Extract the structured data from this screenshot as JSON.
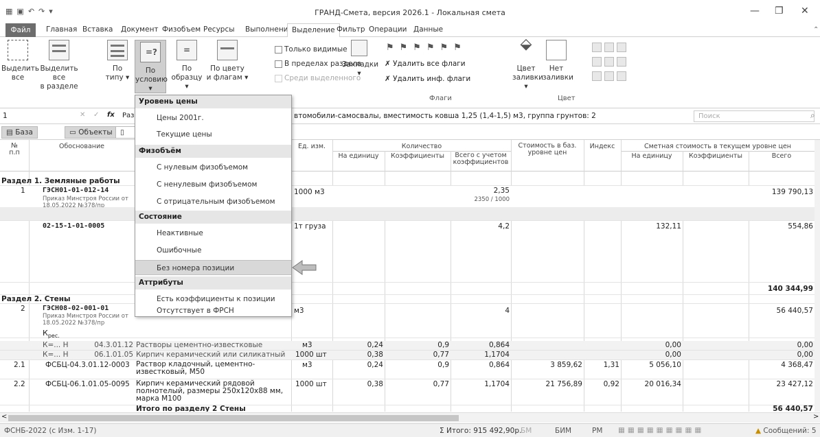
{
  "window": {
    "title": "ГРАНД-Смета, версия 2026.1 - Локальная смета"
  },
  "ribbon_tabs": [
    "Файл",
    "Главная",
    "Вставка",
    "Документ",
    "Физобъем",
    "Ресурсы",
    "Выполнение",
    "Выделение",
    "Фильтр",
    "Операции",
    "Данные"
  ],
  "ribbon": {
    "select_all": "Выделить\nвсе",
    "select_in_section": "Выделить все\nв разделе",
    "by_type": "По\nтипу ▾",
    "by_condition": "По\nусловию ▾",
    "by_sample": "По\nобразцу ▾",
    "by_color": "По цвету\nи флагам ▾",
    "only_visible": "Только видимые",
    "within_section": "В пределах раздела",
    "among_selected": "Среди выделенного",
    "bookmarks": "Закладки\n▾",
    "remove_all_flags": "Удалить все флаги",
    "remove_info_flags": "Удалить инф. флаги",
    "flags_group": "Флаги",
    "fill_color": "Цвет\nзаливки ▾",
    "no_fill": "Нет\nзаливки",
    "color_group": "Цвет"
  },
  "formula_bar": {
    "cell": "1",
    "fx": "fx",
    "text_left": "Разд",
    "text_right": "втомобили-самосвалы, вместимость ковша 1,25 (1,4-1,5) м3, группа грунтов: 2",
    "search_placeholder": "Поиск"
  },
  "doc_tabs": [
    "База",
    "Объекты"
  ],
  "columns": {
    "num": "№\nп.п",
    "basis": "Обоснование",
    "unit": "Ед. изм.",
    "quantity": "Количество",
    "per_unit": "На единицу",
    "coefs": "Коэффициенты",
    "total_with_coef": "Всего с учетом\nкоэффициентов",
    "base_cost": "Стоимость в баз.\nуровне цен",
    "index": "Индекс",
    "current_cost": "Сметная стоимость в текущем уровне цен",
    "cur_per_unit": "На единицу",
    "cur_coefs": "Коэффициенты",
    "cur_total": "Всего"
  },
  "rows": {
    "sec1": "Раздел 1. Земляные работы",
    "r1_num": "1",
    "r1_code": "ГЭСН01-01-012-14",
    "r1_doc": "Приказ Минстроя России от 18.05.2022 №378/пр",
    "r1_unit": "1000 м3",
    "r1_qty": "2,35",
    "r1_qty2": "2350 / 1000",
    "r1_total": "139 790,13",
    "r2_code": "02-15-1-01-0005",
    "r2_unit": "1т груза",
    "r2_qty": "4,2",
    "r2_cur_unit": "132,11",
    "r2_total": "554,86",
    "sum1": "140 344,99",
    "sec2": "Раздел 2. Стены",
    "r3_num": "2",
    "r3_code": "ГЭСН08-02-001-01",
    "r3_doc": "Приказ Минстроя России от 18.05.2022 №378/пр",
    "r3_k": "К",
    "r3_ksub": "рес.",
    "r3_unit": "м3",
    "r3_qty": "4",
    "r3_total": "56 440,57",
    "k1_code": "К=... Н",
    "k1_num": "04.3.01.12",
    "k1_name": "Растворы цементно-известковые",
    "k1_unit": "м3",
    "k1_per": "0,24",
    "k1_coef": "0,9",
    "k1_total": "0,864",
    "k1_cur": "0,00",
    "k1_sum": "0,00",
    "k2_code": "К=... Н",
    "k2_num": "06.1.01.05",
    "k2_name": "Кирпич керамический или силикатный",
    "k2_unit": "1000 шт",
    "k2_per": "0,38",
    "k2_coef": "0,77",
    "k2_total": "1,1704",
    "k2_cur": "0,00",
    "k2_sum": "0,00",
    "r4_num": "2.1",
    "r4_code": "ФСБЦ-04.3.01.12-0003",
    "r4_name": "Раствор кладочный, цементно-известковый, М50",
    "r4_unit": "м3",
    "r4_per": "0,24",
    "r4_coef": "0,9",
    "r4_total": "0,864",
    "r4_base": "3 859,62",
    "r4_idx": "1,31",
    "r4_cur": "5 056,10",
    "r4_sum": "4 368,47",
    "r5_num": "2.2",
    "r5_code": "ФСБЦ-06.1.01.05-0095",
    "r5_name": "Кирпич керамический рядовой полнотелый, размеры 250х120х88 мм, марка М100",
    "r5_unit": "1000 шт",
    "r5_per": "0,38",
    "r5_coef": "0,77",
    "r5_total": "1,1704",
    "r5_base": "21 756,89",
    "r5_idx": "0,92",
    "r5_cur": "20 016,34",
    "r5_sum": "23 427,12",
    "sum2_label": "Итого по разделу 2 Стены",
    "sum2": "56 440,57"
  },
  "dropdown": {
    "h1": "Уровень цены",
    "i1": "Цены 2001г.",
    "i2": "Текущие цены",
    "h2": "Физобъём",
    "i3": "С нулевым физобъемом",
    "i4": "С ненулевым физобъемом",
    "i5": "С отрицательным физобъемом",
    "h3": "Состояние",
    "i6": "Неактивные",
    "i7": "Ошибочные",
    "i8": "Без номера позиции",
    "h4": "Аттрибуты",
    "i9": "Есть коэффициенты к позиции",
    "i10": "Отсутствует в ФРСН"
  },
  "status": {
    "left": "ФСНБ-2022 (с Изм. 1-17)",
    "total": "Итого: 915 492,90р.",
    "bm": "БМ",
    "bim": "БИМ",
    "rm": "РМ",
    "messages": "Сообщений: 5"
  }
}
